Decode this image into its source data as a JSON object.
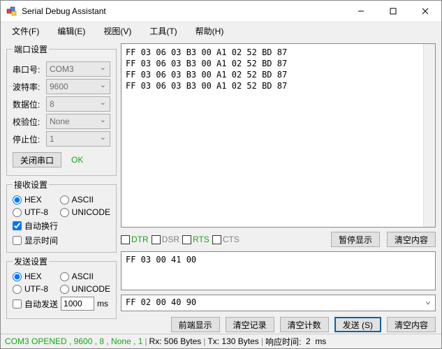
{
  "title": "Serial Debug Assistant",
  "menu": {
    "file": "文件(F)",
    "edit": "编辑(E)",
    "view": "视图(V)",
    "tools": "工具(T)",
    "help": "帮助(H)"
  },
  "port": {
    "legend": "端口设置",
    "labels": {
      "port": "串口号:",
      "baud": "波特率:",
      "data": "数据位:",
      "parity": "校验位:",
      "stop": "停止位:"
    },
    "values": {
      "port": "COM3",
      "baud": "9600",
      "data": "8",
      "parity": "None",
      "stop": "1"
    },
    "close_btn": "关闭串口",
    "ok": "OK"
  },
  "rx": {
    "legend": "接收设置",
    "hex": "HEX",
    "ascii": "ASCII",
    "utf8": "UTF-8",
    "unicode": "UNICODE",
    "wrap": "自动换行",
    "time": "显示时间"
  },
  "tx": {
    "legend": "发送设置",
    "hex": "HEX",
    "ascii": "ASCII",
    "utf8": "UTF-8",
    "unicode": "UNICODE",
    "auto": "自动发送",
    "interval": "1000",
    "ms": "ms"
  },
  "rx_data": "FF 03 06 03 B3 00 A1 02 52 BD 87\nFF 03 06 03 B3 00 A1 02 52 BD 87\nFF 03 06 03 B3 00 A1 02 52 BD 87\nFF 03 06 03 B3 00 A1 02 52 BD 87",
  "signals": {
    "dtr": "DTR",
    "dsr": "DSR",
    "rts": "RTS",
    "cts": "CTS"
  },
  "tx_input": "FF 03 00 41 00",
  "tx_history": "FF 02 00 40 90",
  "buttons": {
    "pause": "暂停显示",
    "clear_rx": "清空内容",
    "front": "前端显示",
    "clear_log": "清空记录",
    "clear_cnt": "清空计数",
    "send": "发送 (S)",
    "clear_tx": "清空内容"
  },
  "status": {
    "open": "COM3 OPENED , 9600 , 8 , None , 1",
    "rx_lbl": "Rx:",
    "rx_val": "506",
    "tx_lbl": "Tx:",
    "tx_val": "130",
    "bytes": "Bytes",
    "resp_lbl": "响应时间:",
    "resp_val": "2",
    "ms": "ms"
  }
}
